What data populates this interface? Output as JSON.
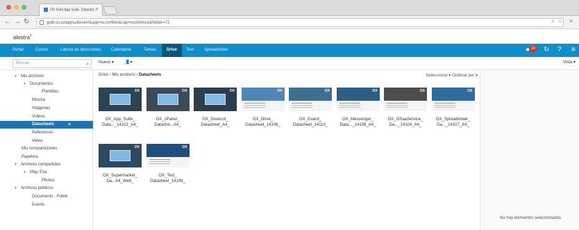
{
  "browser": {
    "tab_title": "OX Gold App Suite, Datashe...",
    "url": "gold.ox.io/appsuite/ui#!&app=io.ox/files&cap=customize&folder=72"
  },
  "app": {
    "name": "alestra"
  },
  "nav": {
    "items": [
      "Portal",
      "Correo",
      "Libreta de direcciones",
      "Calendario",
      "Tareas",
      "Drive",
      "Text",
      "Spreadsheet"
    ],
    "active": "Drive",
    "notification_count": "10"
  },
  "toolbar": {
    "search_placeholder": "Buscar...",
    "new_label": "Nuevo ▾",
    "share_label": "▾",
    "view_label": "Vista ▾"
  },
  "sidebar": {
    "items": [
      {
        "label": "Mis archivos",
        "caret": "▼"
      },
      {
        "label": "Documentos",
        "caret": "▼"
      },
      {
        "label": "Plantillas",
        "caret": ""
      },
      {
        "label": "Música",
        "caret": ""
      },
      {
        "label": "Imágenes",
        "caret": ""
      },
      {
        "label": "Vídeos",
        "caret": ""
      },
      {
        "label": "Datasheets",
        "caret": ""
      },
      {
        "label": "References",
        "caret": ""
      },
      {
        "label": "Video",
        "caret": ""
      },
      {
        "label": "Mis comparticiones",
        "caret": ""
      },
      {
        "label": "Papelera",
        "caret": ""
      },
      {
        "label": "Archivos compartidos",
        "caret": "▼"
      },
      {
        "label": "May, Eva",
        "caret": "▼"
      },
      {
        "label": "Photos",
        "caret": ""
      },
      {
        "label": "Archivos públicos",
        "caret": "▼"
      },
      {
        "label": "Documents - Public",
        "caret": ""
      },
      {
        "label": "Events",
        "caret": ""
      }
    ]
  },
  "main": {
    "breadcrumb_root": "Drive",
    "breadcrumb_mid": "Mis archivos",
    "breadcrumb_current": "Datasheets",
    "controls": "Seleccionar ▾  Ordenar por ▾",
    "files": [
      {
        "line1": "OX_App_Suite_",
        "line2": "Data..._14102_A4_",
        "style": "dark",
        "color": "#2a4456"
      },
      {
        "line1": "OX_cPanel_",
        "line2": "Datashe...A4_",
        "style": "dark",
        "color": "#3c4b57"
      },
      {
        "line1": "OX_Dovecot_",
        "line2": "Datasheet_A4_",
        "style": "dark",
        "color": "#2c3d4b"
      },
      {
        "line1": "OX_Drive_",
        "line2": "Datasheet_14106_",
        "style": "light",
        "color": "#4f86b3"
      },
      {
        "line1": "OX_Guard_",
        "line2": "Datasheet_14110_",
        "style": "light",
        "color": "#3e6e91"
      },
      {
        "line1": "OX_Messenger_",
        "line2": "Data..._14108_A4_",
        "style": "light",
        "color": "#2d5e86"
      },
      {
        "line1": "OX_OXaaService_",
        "line2": "Da..._14104_A4_",
        "style": "light",
        "color": "#4d4d4d"
      },
      {
        "line1": "OX_Spreadsheet_",
        "line2": "Da..._14107_A4_",
        "style": "light",
        "color": "#2f6aa0"
      },
      {
        "line1": "OX_Supermarket_",
        "line2": "Da...A4_Web_",
        "style": "dark",
        "color": "#2e4a60"
      },
      {
        "line1": "OX_Text_",
        "line2": "Datasheet_14108_",
        "style": "light",
        "color": "#1f4f7e"
      }
    ]
  },
  "right_panel": {
    "empty_text": "No hay elementos seleccionados"
  },
  "colors": {
    "nav_bg": "#0e8fcb",
    "nav_active": "#08587e",
    "selection": "#1d73b3",
    "badge": "#e02f2f"
  }
}
